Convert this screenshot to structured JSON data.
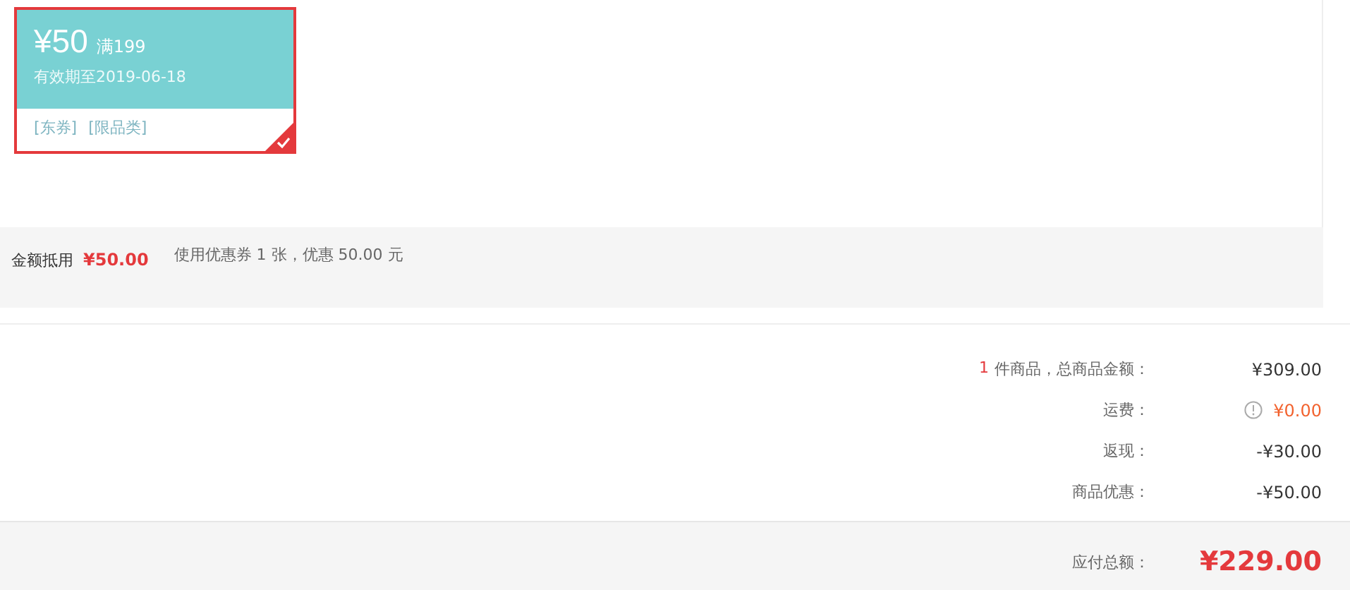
{
  "coupons": [
    {
      "amount": "¥50",
      "condition": "满199",
      "expiry": "有效期至2019-06-18",
      "tags": [
        "[东券]",
        "[限品类]"
      ],
      "selected": true
    }
  ],
  "coupon_summary": {
    "label": "金额抵用",
    "amount": "¥50.00",
    "note": "使用优惠券 1 张，优惠 50.00 元"
  },
  "summary_rows": [
    {
      "kind": "count",
      "count": "1",
      "label": "件商品，总商品金额：",
      "value": "¥309.00"
    },
    {
      "kind": "shipping",
      "label": "运费：",
      "value": "¥0.00"
    },
    {
      "kind": "plain",
      "label": "返现：",
      "value": "-¥30.00"
    },
    {
      "kind": "plain",
      "label": "商品优惠：",
      "value": "-¥50.00"
    }
  ],
  "total": {
    "label": "应付总额：",
    "value": "¥229.00"
  }
}
